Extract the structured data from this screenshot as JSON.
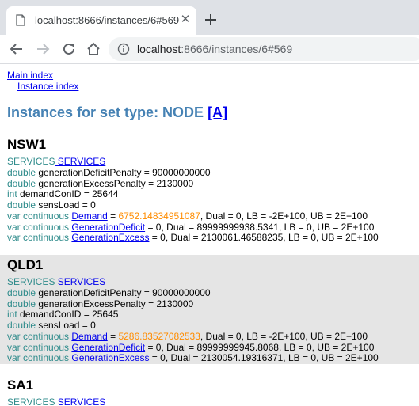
{
  "browser": {
    "tab_title": "localhost:8666/instances/6#569",
    "url_host": "localhost",
    "url_path": ":8666/instances/6#569"
  },
  "nav": {
    "main_index": "Main index",
    "instance_index": "Instance index"
  },
  "page": {
    "title_prefix": "Instances for set type: NODE",
    "title_link": "[A]"
  },
  "nodes": [
    {
      "name": "NSW1",
      "services_kw": "SERVICES",
      "services_link": " SERVICES",
      "lines": [
        {
          "kw": "double",
          "text": " generationDeficitPenalty = 90000000000"
        },
        {
          "kw": "double",
          "text": " generationExcessPenalty = 2130000"
        },
        {
          "kw": "int",
          "text": " demandConID = 25644"
        },
        {
          "kw": "double",
          "text": " sensLoad = 0"
        }
      ],
      "vars": [
        {
          "kw": "var continuous",
          "link": "Demand",
          "eq": " = ",
          "value": "6752.14834951087",
          "highlight": true,
          "rest": ", Dual = 0, LB = -2E+100, UB = 2E+100"
        },
        {
          "kw": "var continuous",
          "link": "GenerationDeficit",
          "eq": " = ",
          "value": "0",
          "highlight": false,
          "rest": ", Dual = 89999999938.5341, LB = 0, UB = 2E+100"
        },
        {
          "kw": "var continuous",
          "link": "GenerationExcess",
          "eq": " = ",
          "value": "0",
          "highlight": false,
          "rest": ", Dual = 2130061.46588235, LB = 0, UB = 2E+100"
        }
      ]
    },
    {
      "name": "QLD1",
      "services_kw": "SERVICES",
      "services_link": " SERVICES",
      "lines": [
        {
          "kw": "double",
          "text": " generationDeficitPenalty = 90000000000"
        },
        {
          "kw": "double",
          "text": " generationExcessPenalty = 2130000"
        },
        {
          "kw": "int",
          "text": " demandConID = 25645"
        },
        {
          "kw": "double",
          "text": " sensLoad = 0"
        }
      ],
      "vars": [
        {
          "kw": "var continuous",
          "link": "Demand",
          "eq": " = ",
          "value": "5286.83527082533",
          "highlight": true,
          "rest": ", Dual = 0, LB = -2E+100, UB = 2E+100"
        },
        {
          "kw": "var continuous",
          "link": "GenerationDeficit",
          "eq": " = ",
          "value": "0",
          "highlight": false,
          "rest": ", Dual = 89999999945.8068, LB = 0, UB = 2E+100"
        },
        {
          "kw": "var continuous",
          "link": "GenerationExcess",
          "eq": " = ",
          "value": "0",
          "highlight": false,
          "rest": ", Dual = 2130054.19316371, LB = 0, UB = 2E+100"
        }
      ]
    },
    {
      "name": "SA1",
      "services_kw": "SERVICES",
      "services_link": " SERVICES",
      "lines": [],
      "vars": []
    }
  ],
  "colors": {
    "keyword": "#2e8b8b",
    "link": "#0000ee",
    "title": "#4682b4",
    "highlight_value": "#ff8c00",
    "shaded_row": "#e5e5e5"
  },
  "icons": [
    "page-favicon-icon",
    "close-icon",
    "plus-icon",
    "arrow-back-icon",
    "arrow-forward-icon",
    "reload-icon",
    "home-icon",
    "info-icon"
  ]
}
